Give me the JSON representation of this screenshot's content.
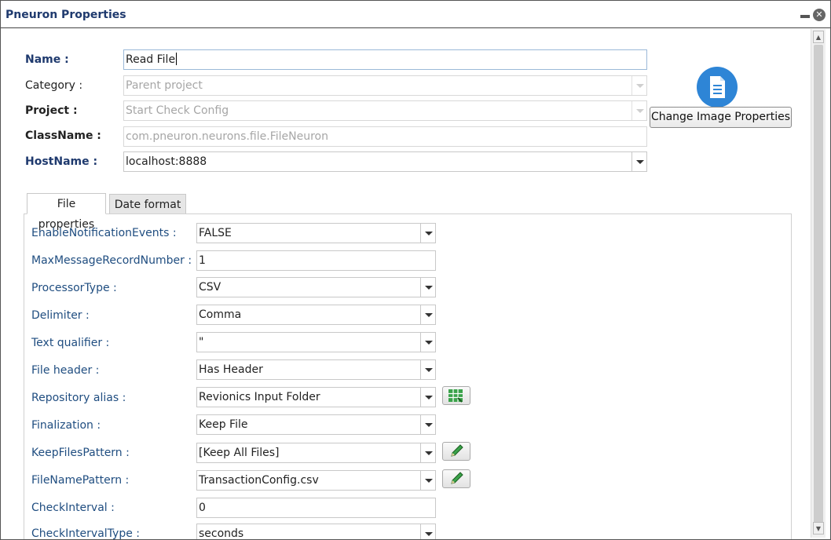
{
  "window": {
    "title": "Pneuron Properties"
  },
  "header_fields": {
    "name": {
      "label": "Name :",
      "value": "Read File"
    },
    "category": {
      "label": "Category :",
      "value": "Parent project"
    },
    "project": {
      "label": "Project :",
      "value": "Start Check Config"
    },
    "classname": {
      "label": "ClassName :",
      "value": "com.pneuron.neurons.file.FileNeuron"
    },
    "hostname": {
      "label": "HostName :",
      "value": "localhost:8888"
    }
  },
  "image": {
    "icon": "document-icon",
    "button_label": "Change Image Properties",
    "icon_color": "#2e85d6"
  },
  "tabs": [
    {
      "label": "File properties",
      "active": true
    },
    {
      "label": "Date format",
      "active": false
    }
  ],
  "file_properties": {
    "enable_notification_events": {
      "label": "EnableNotificationEvents :",
      "value": "FALSE"
    },
    "max_message_record_number": {
      "label": "MaxMessageRecordNumber :",
      "value": "1"
    },
    "processor_type": {
      "label": "ProcessorType :",
      "value": "CSV"
    },
    "delimiter": {
      "label": "Delimiter :",
      "value": "Comma"
    },
    "text_qualifier": {
      "label": "Text qualifier :",
      "value": "\""
    },
    "file_header": {
      "label": "File header :",
      "value": "Has Header"
    },
    "repository_alias": {
      "label": "Repository alias :",
      "value": "Revionics Input Folder"
    },
    "finalization": {
      "label": "Finalization :",
      "value": "Keep File"
    },
    "keep_files_pattern": {
      "label": "KeepFilesPattern :",
      "value": "[Keep All Files]"
    },
    "file_name_pattern": {
      "label": "FileNamePattern :",
      "value": "TransactionConfig.csv"
    },
    "check_interval": {
      "label": "CheckInterval :",
      "value": "0"
    },
    "check_interval_type": {
      "label": "CheckIntervalType :",
      "value": "seconds"
    }
  },
  "colors": {
    "label_navy": "#1f3a6e",
    "label_blue": "#1f4d80",
    "grid_button_green": "#3aa24a"
  }
}
